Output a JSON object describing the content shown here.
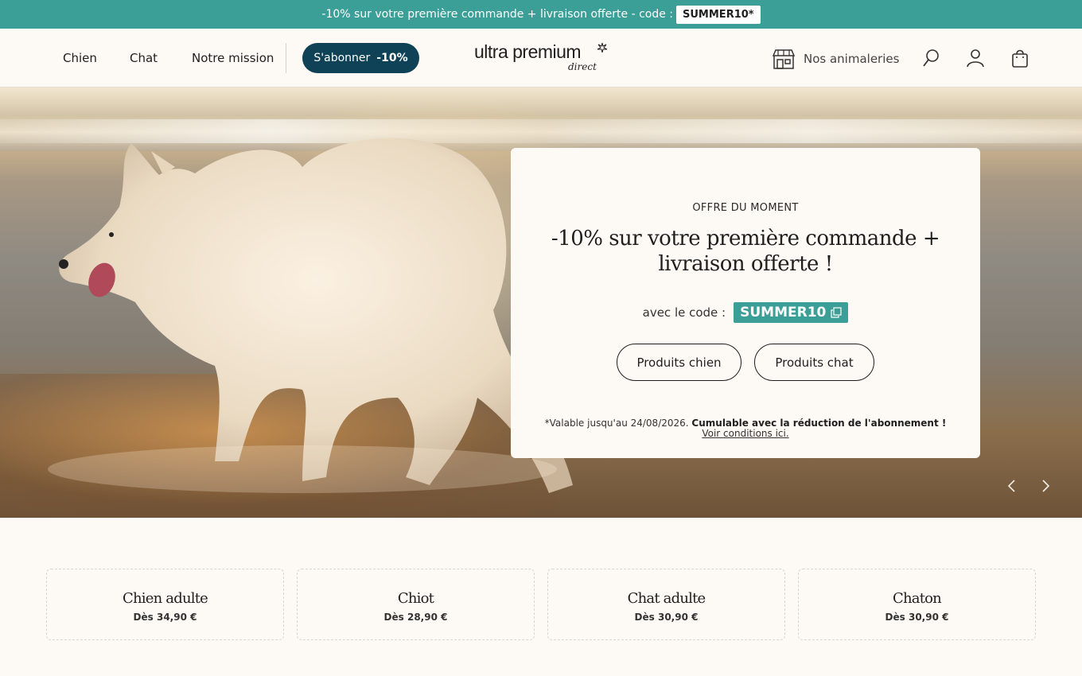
{
  "announcement": {
    "text": "-10% sur votre première commande + livraison offerte - code :",
    "code": "SUMMER10*"
  },
  "nav": {
    "items": [
      "Chien",
      "Chat",
      "Notre mission"
    ],
    "subscribe_label": "S'abonner",
    "subscribe_discount": "-10%"
  },
  "logo": {
    "main": "ultra premium",
    "sub": "direct"
  },
  "header_actions": {
    "stores_label": "Nos animaleries"
  },
  "hero": {
    "eyebrow": "OFFRE DU MOMENT",
    "headline": "-10% sur votre première commande + livraison offerte !",
    "code_prefix": "avec le code :",
    "code": "SUMMER10",
    "buttons": [
      "Produits chien",
      "Produits chat"
    ],
    "fine_print": "*Valable jusqu'au 24/08/2026.",
    "fine_bold": "Cumulable avec la réduction de l'abonnement !",
    "conditions_link": "Voir conditions ici."
  },
  "categories": [
    {
      "name": "Chien adulte",
      "price": "Dès 34,90 €"
    },
    {
      "name": "Chiot",
      "price": "Dès 28,90 €"
    },
    {
      "name": "Chat adulte",
      "price": "Dès 30,90 €"
    },
    {
      "name": "Chaton",
      "price": "Dès 30,90 €"
    }
  ],
  "colors": {
    "teal": "#3b9e97",
    "navy": "#0f4257",
    "cream": "#fdf9f5"
  },
  "icons": [
    "store-icon",
    "search-icon",
    "user-icon",
    "bag-icon",
    "copy-icon",
    "chevron-left-icon",
    "chevron-right-icon"
  ]
}
